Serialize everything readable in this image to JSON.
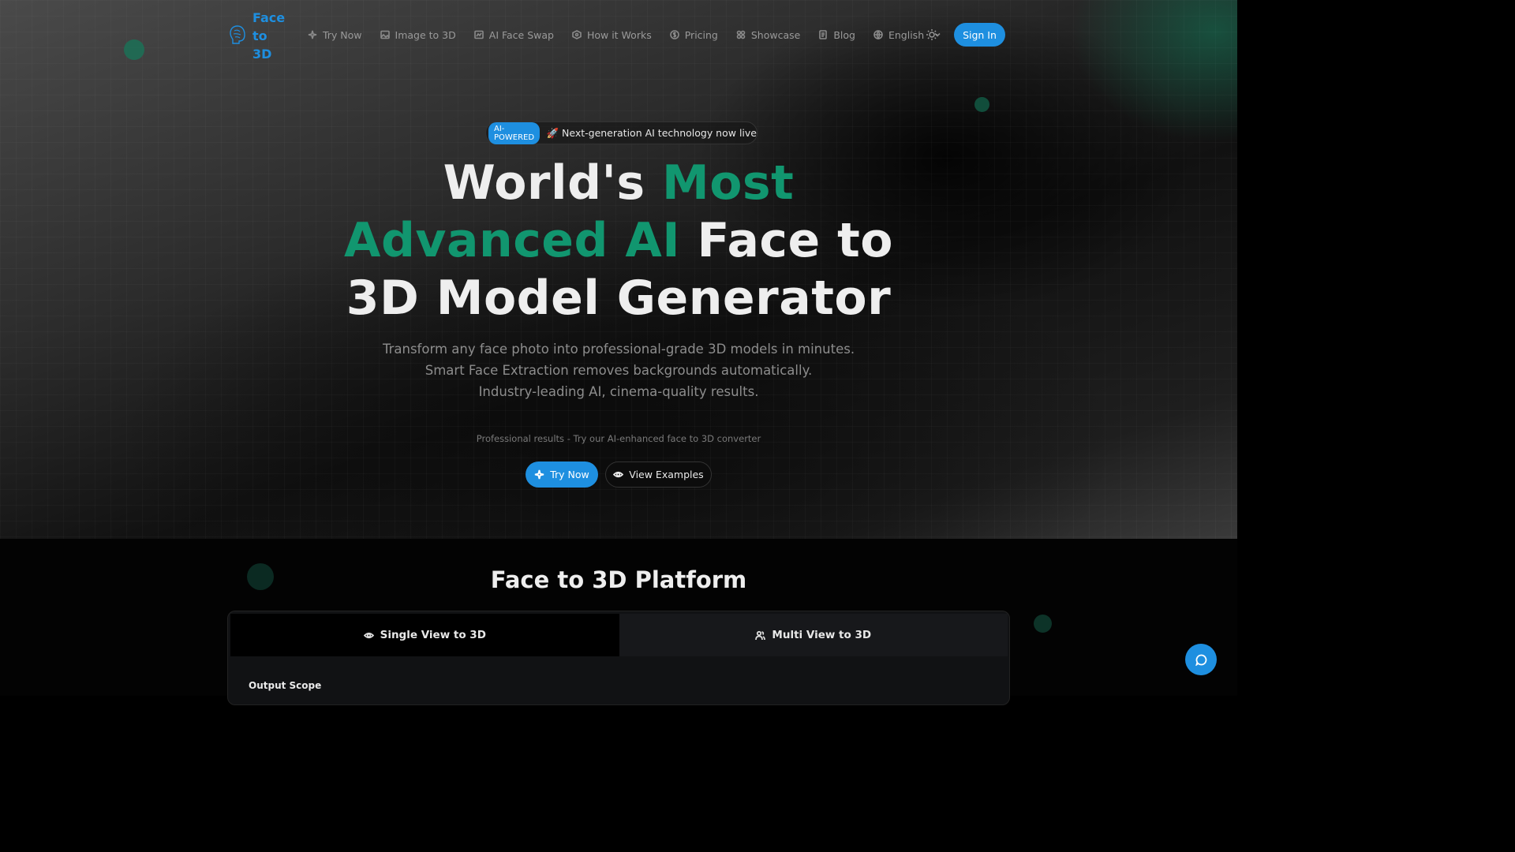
{
  "brand": {
    "name_line1": "Face",
    "name_line2": "to",
    "name_line3": "3D",
    "accent_color": "#1e8fe0",
    "green_color": "#11966f"
  },
  "nav": {
    "items": [
      {
        "label": "Try Now",
        "icon": "sparkles-icon"
      },
      {
        "label": "Image to 3D",
        "icon": "image-icon"
      },
      {
        "label": "AI Face Swap",
        "icon": "image-swap-icon"
      },
      {
        "label": "How it Works",
        "icon": "cube-icon"
      },
      {
        "label": "Pricing",
        "icon": "dollar-icon"
      },
      {
        "label": "Showcase",
        "icon": "grid-icon"
      },
      {
        "label": "Blog",
        "icon": "document-icon"
      }
    ],
    "language": "English",
    "theme_toggle": "sun-icon",
    "sign_in": "Sign In"
  },
  "hero": {
    "badge": "AI-POWERED",
    "announcement": "🚀 Next-generation AI technology now live",
    "headline_part1": "World's ",
    "headline_green": "Most Advanced AI",
    "headline_part2": " Face to 3D Model Generator",
    "subtitle_line1": "Transform any face photo into professional-grade 3D models in minutes.",
    "subtitle_line2": "Smart Face Extraction removes backgrounds automatically.",
    "subtitle_line3": "Industry-leading AI, cinema-quality results.",
    "note": "Professional results - Try our AI-enhanced face to 3D converter",
    "cta_primary": "Try Now",
    "cta_secondary": "View Examples"
  },
  "platform": {
    "title": "Face to 3D Platform",
    "tabs": [
      {
        "label": "Single View to 3D",
        "icon": "eye-icon",
        "active": true
      },
      {
        "label": "Multi View to 3D",
        "icon": "users-icon",
        "active": false
      }
    ],
    "output_scope_label": "Output Scope"
  },
  "chat": {
    "icon": "chat-icon"
  }
}
